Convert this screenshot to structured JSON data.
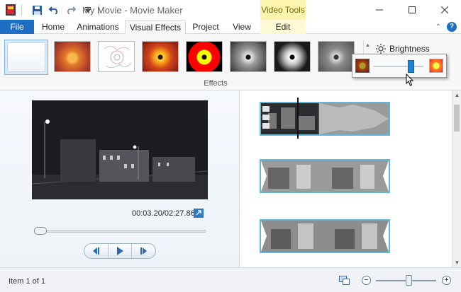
{
  "window": {
    "title": "My Movie - Movie Maker",
    "context_tab_group": "Video Tools"
  },
  "quick_access": {
    "icons": [
      "app-icon",
      "save-icon",
      "undo-icon",
      "redo-icon",
      "customize-icon"
    ]
  },
  "tabs": [
    {
      "label": "File"
    },
    {
      "label": "Home"
    },
    {
      "label": "Animations"
    },
    {
      "label": "Visual Effects"
    },
    {
      "label": "Project"
    },
    {
      "label": "View"
    },
    {
      "label": "Edit"
    }
  ],
  "ribbon": {
    "group_label": "Effects",
    "brightness_label": "Brightness",
    "brightness_level": 0.75,
    "effects": [
      "No effect",
      "Blur",
      "Edge detection",
      "Original",
      "Posterize",
      "Black and white",
      "Black and white high contrast",
      "Black and white low contrast"
    ]
  },
  "preview": {
    "timecode": "00:03.20/02:27.86",
    "seek_position": 0.02
  },
  "status": {
    "item_text": "Item 1 of 1",
    "zoom_level": 0.55
  },
  "colors": {
    "file_tab": "#1e6fc4",
    "context_band": "#fbf5b0",
    "clip_border": "#5eb8d6",
    "slider_thumb": "#1e82d6"
  }
}
